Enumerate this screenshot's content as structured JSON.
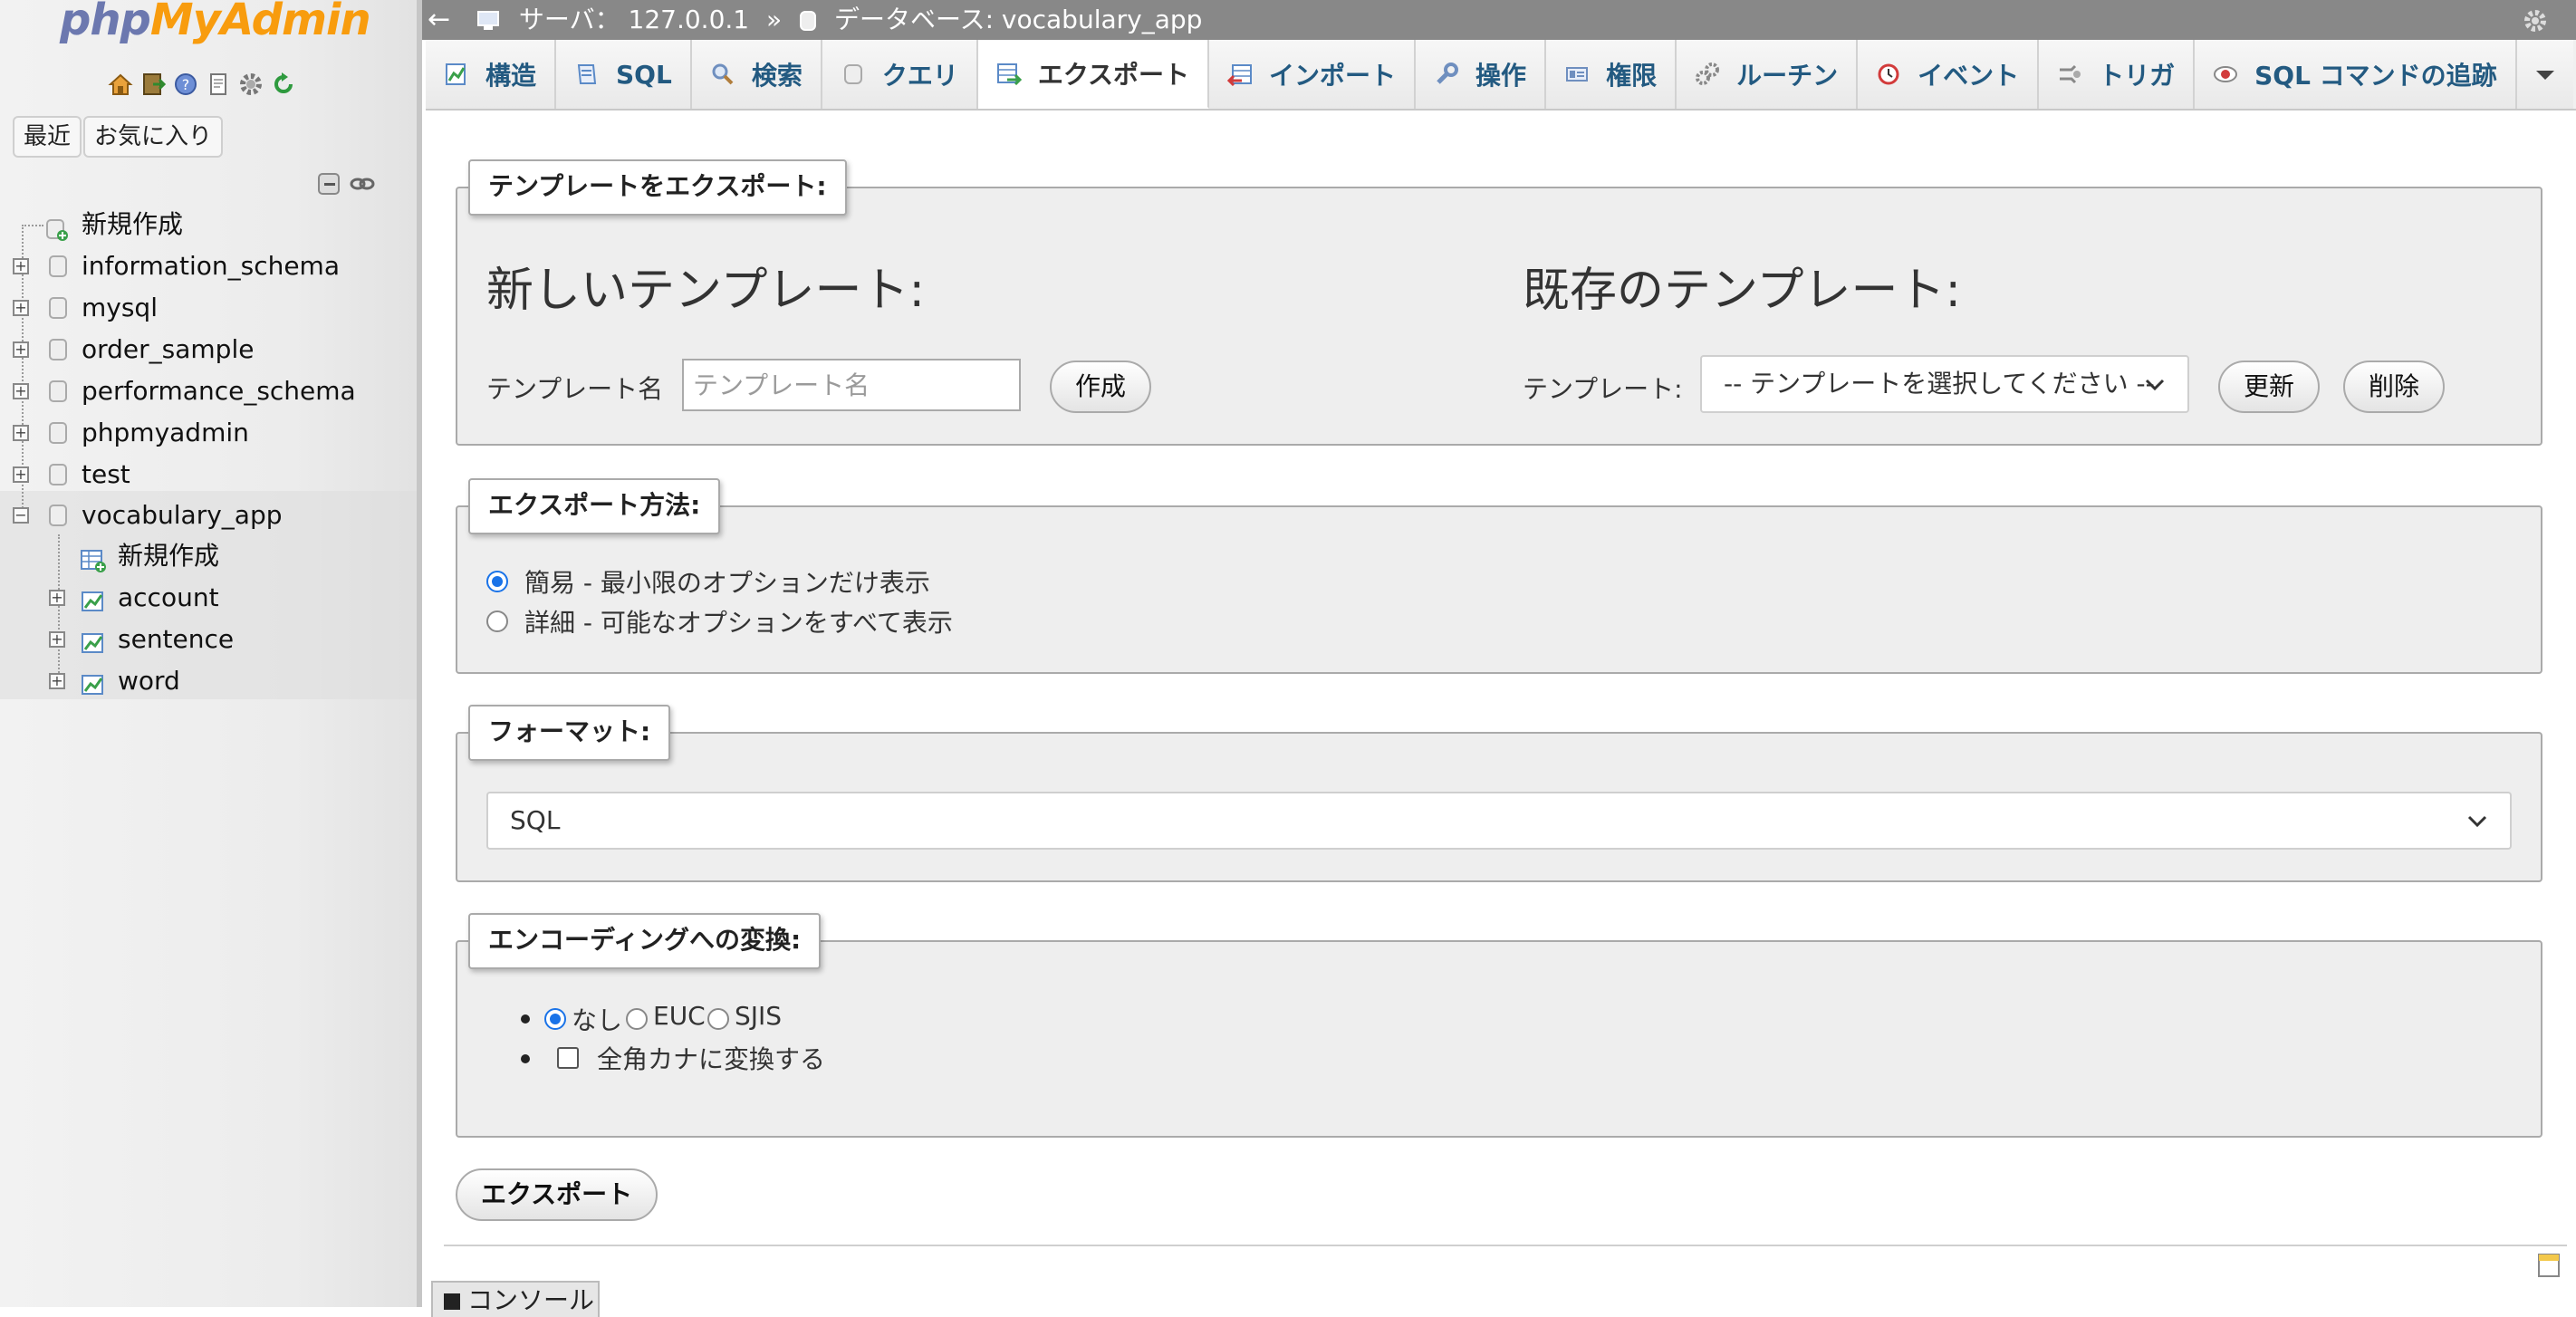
{
  "sidebar": {
    "logo_php": "php",
    "logo_myadmin": "MyAdmin",
    "quick_icons": [
      "home-icon",
      "exit-icon",
      "help-icon",
      "docs-icon",
      "settings-icon",
      "reload-icon"
    ],
    "recent_label": "最近",
    "favorites_label": "お気に入り",
    "tree": {
      "new_label": "新規作成",
      "databases": [
        "information_schema",
        "mysql",
        "order_sample",
        "performance_schema",
        "phpmyadmin",
        "test",
        "vocabulary_app"
      ],
      "vocab_new_label": "新規作成",
      "tables": [
        "account",
        "sentence",
        "word"
      ]
    }
  },
  "topbar": {
    "back": "←",
    "server_label": "サーバ： 127.0.0.1",
    "sep": "»",
    "db_label": "データベース: vocabulary_app"
  },
  "tabs": [
    {
      "label": "構造",
      "icon": "structure-icon"
    },
    {
      "label": "SQL",
      "icon": "sql-icon"
    },
    {
      "label": "検索",
      "icon": "search-icon"
    },
    {
      "label": "クエリ",
      "icon": "query-icon"
    },
    {
      "label": "エクスポート",
      "icon": "export-icon"
    },
    {
      "label": "インポート",
      "icon": "import-icon"
    },
    {
      "label": "操作",
      "icon": "operations-icon"
    },
    {
      "label": "権限",
      "icon": "privileges-icon"
    },
    {
      "label": "ルーチン",
      "icon": "routines-icon"
    },
    {
      "label": "イベント",
      "icon": "events-icon"
    },
    {
      "label": "トリガ",
      "icon": "triggers-icon"
    },
    {
      "label": "SQL コマンドの追跡",
      "icon": "tracking-icon"
    }
  ],
  "template_export": {
    "legend": "テンプレートをエクスポート:",
    "new_heading": "新しいテンプレート:",
    "existing_heading": "既存のテンプレート:",
    "name_label": "テンプレート名",
    "name_placeholder": "テンプレート名",
    "create_button": "作成",
    "template_label": "テンプレート:",
    "template_select": "-- テンプレートを選択してください --",
    "update_button": "更新",
    "delete_button": "削除"
  },
  "export_method": {
    "legend": "エクスポート方法:",
    "option_quick": "簡易 - 最小限のオプションだけ表示",
    "option_custom": "詳細 - 可能なオプションをすべて表示",
    "selected": "quick"
  },
  "format": {
    "legend": "フォーマット:",
    "value": "SQL"
  },
  "encoding": {
    "legend": "エンコーディングへの変換:",
    "options": [
      "なし",
      "EUC",
      "SJIS"
    ],
    "selected": "なし",
    "kana_label": "全角カナに変換する"
  },
  "export_button": "エクスポート",
  "console_label": "コンソール",
  "colors": {
    "accent": "#235a81",
    "radio": "#1a73e8",
    "logo_php": "#6c78af",
    "logo_myadmin": "#f89c0e"
  }
}
